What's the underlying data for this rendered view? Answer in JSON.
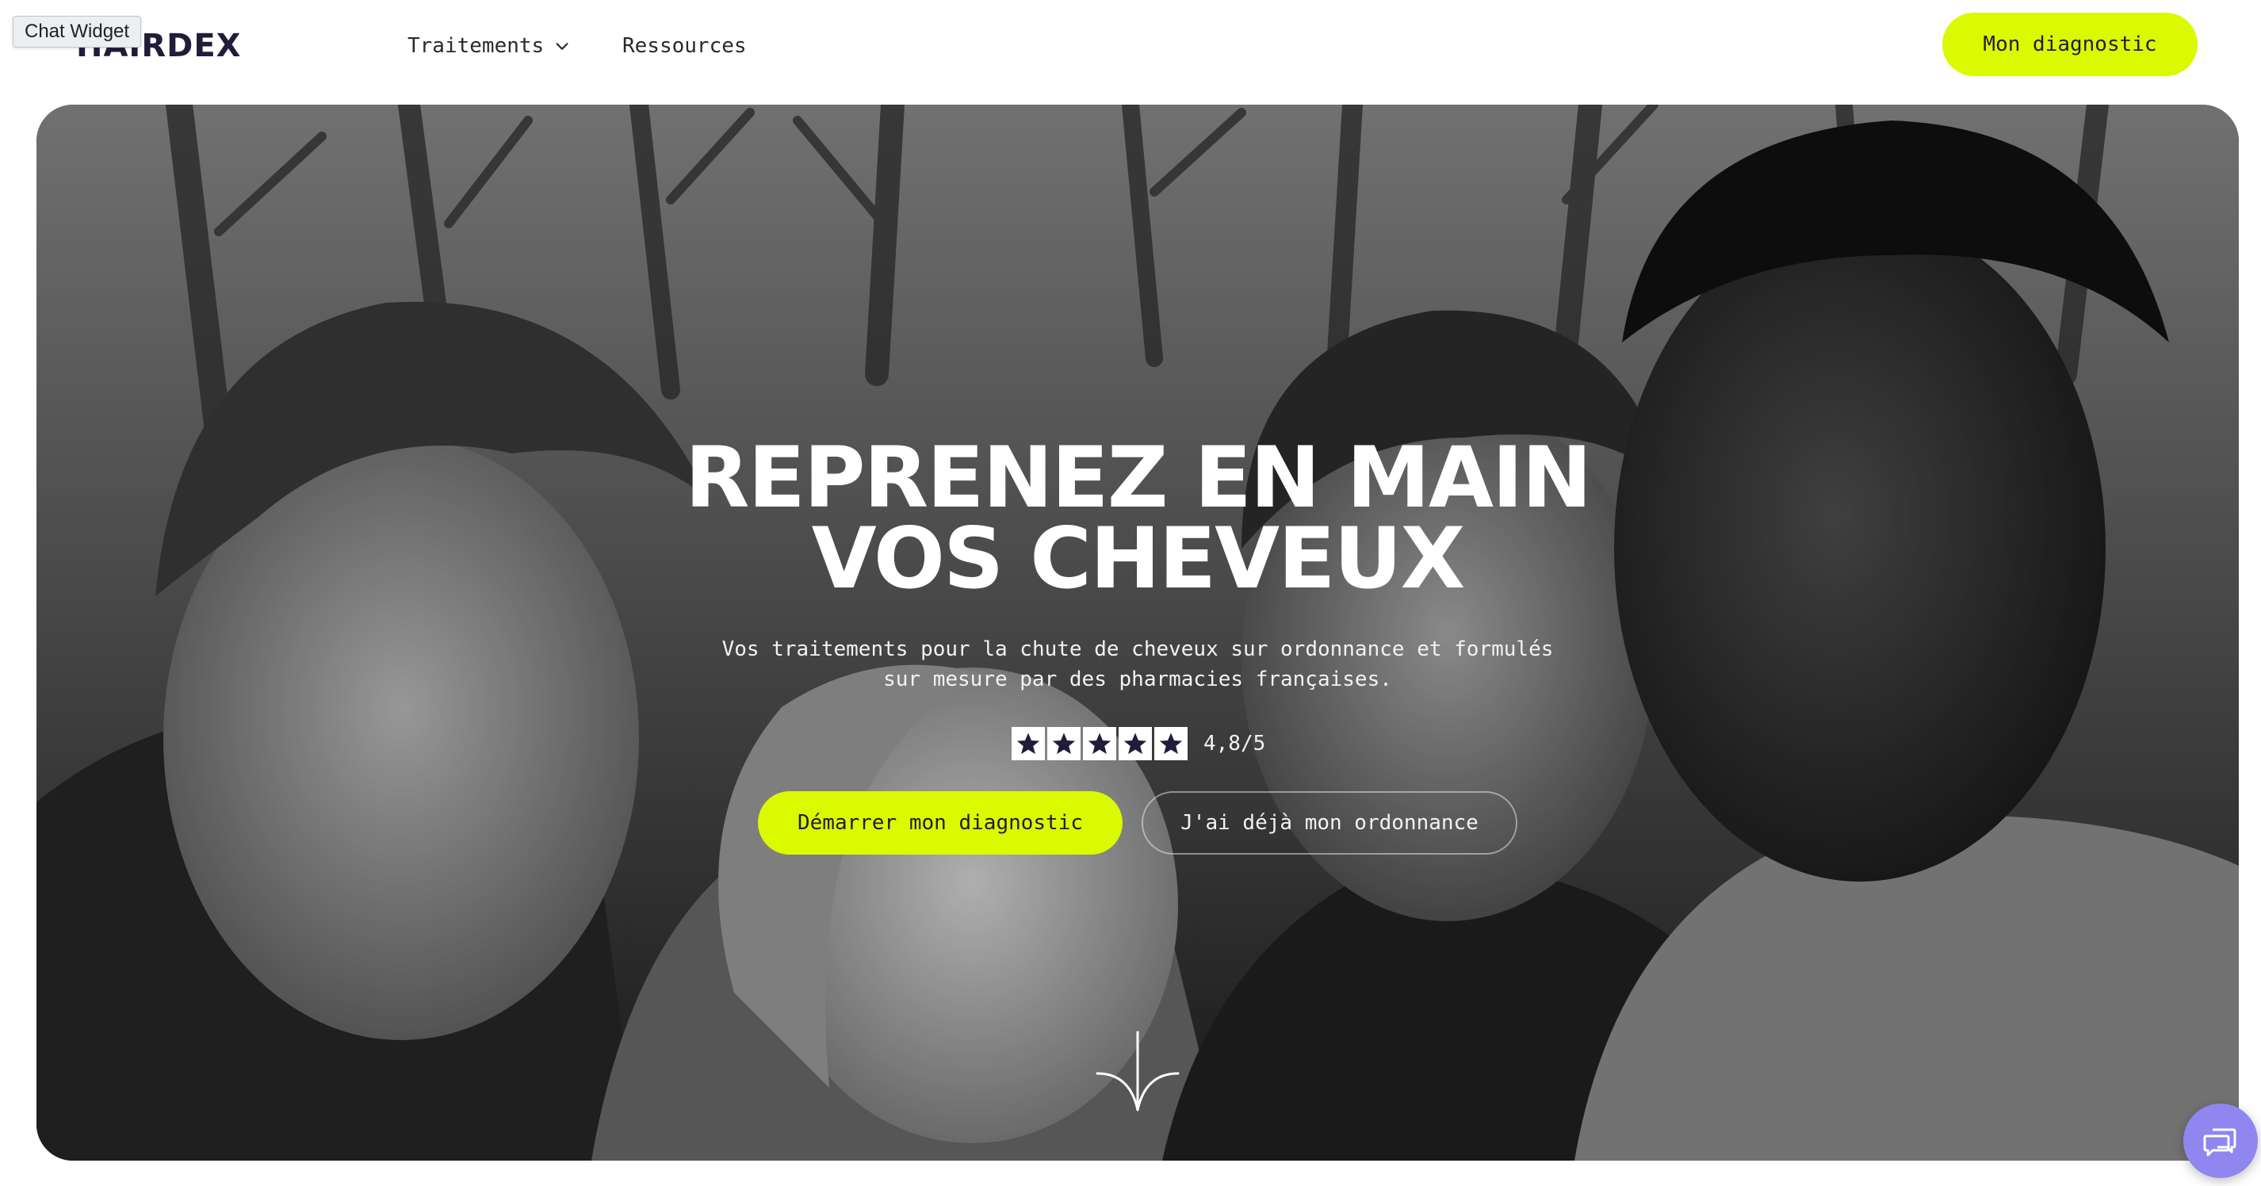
{
  "header": {
    "logo_text": "HAIRDEX",
    "nav": [
      {
        "label": "Traitements",
        "has_dropdown": true
      },
      {
        "label": "Ressources",
        "has_dropdown": false
      }
    ],
    "cta_label": "Mon diagnostic",
    "chat_tooltip": "Chat Widget"
  },
  "hero": {
    "title_line1": "REPRENEZ EN MAIN",
    "title_line2": "VOS CHEVEUX",
    "subtitle_line1": "Vos traitements pour la chute de cheveux sur ordonnance et formulés",
    "subtitle_line2": "sur mesure par des pharmacies françaises.",
    "rating": {
      "stars": 5,
      "value_text": "4,8/5"
    },
    "primary_cta": "Démarrer mon diagnostic",
    "secondary_cta": "J'ai déjà mon ordonnance",
    "image_description_icon": "group-of-smiling-people-photo"
  },
  "icons": {
    "dropdown": "chevron-down-icon",
    "scroll": "arrow-down-icon",
    "chat": "chat-bubbles-icon",
    "star": "star-icon"
  },
  "colors": {
    "accent": "#dbf900",
    "text_dark": "#1f1d3a",
    "chat_launcher": "#8f86f0"
  }
}
